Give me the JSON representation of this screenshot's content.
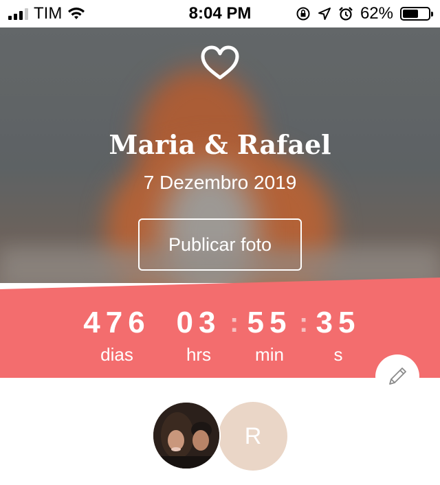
{
  "status_bar": {
    "carrier": "TIM",
    "time": "8:04 PM",
    "battery": "62%",
    "battery_level": 0.62
  },
  "hero": {
    "icon": "heart-icon",
    "couple_names": "Maria & Rafael",
    "wedding_date": "7 Dezembro 2019",
    "publish_button": "Publicar foto"
  },
  "countdown": {
    "days": "476",
    "days_label": "dias",
    "hours": "03",
    "hours_label": "hrs",
    "minutes": "55",
    "minutes_label": "min",
    "seconds": "35",
    "seconds_label": "s",
    "separator": ":"
  },
  "edit_icon": "pencil-icon",
  "partners": {
    "second_initial": "R"
  },
  "colors": {
    "accent": "#f36d6e",
    "avatar_placeholder": "#ead6c7"
  }
}
